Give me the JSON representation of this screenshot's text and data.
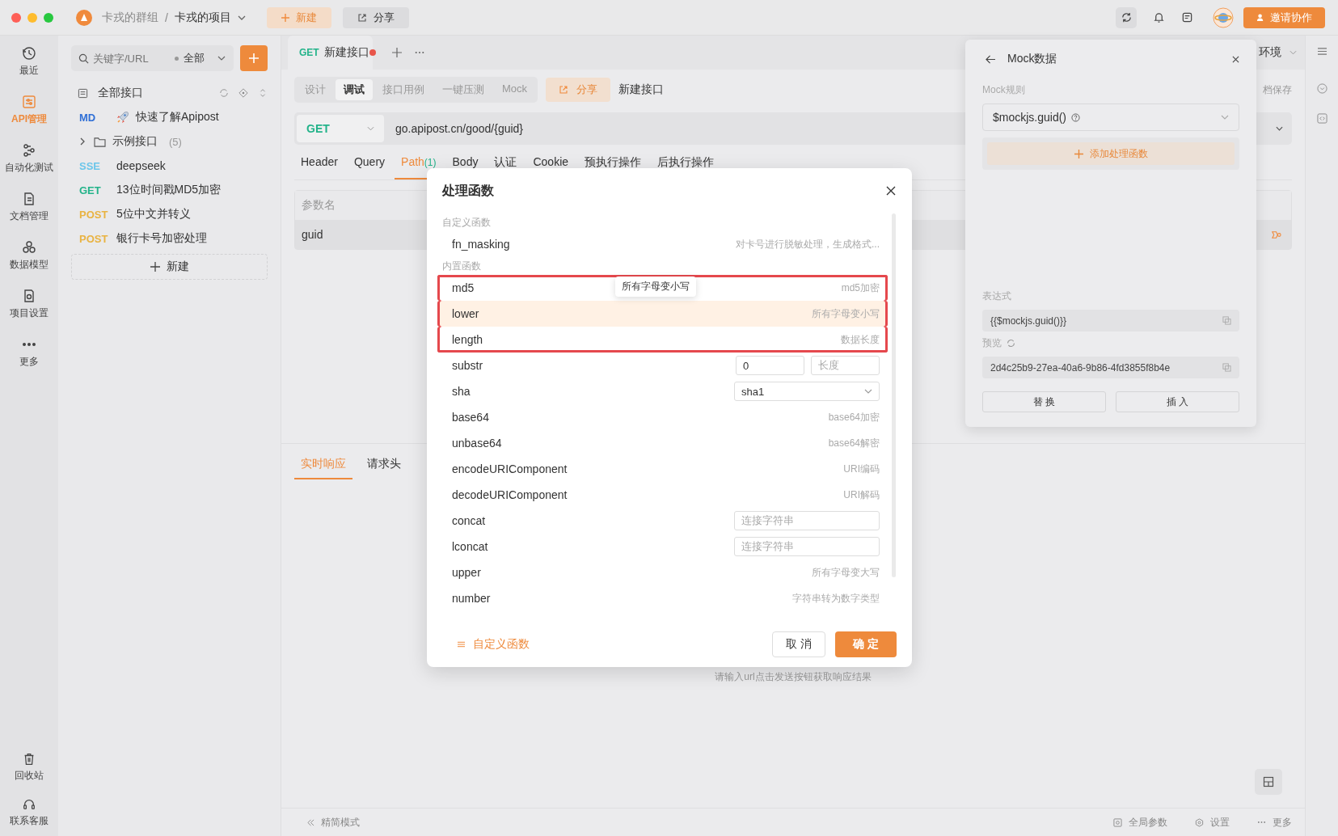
{
  "topbar": {
    "group": "卡戎的群组",
    "separator": "/",
    "project": "卡戎的项目",
    "new_button": "新建",
    "share_button": "分享",
    "invite_button": "邀请协作"
  },
  "rail": {
    "items": [
      {
        "label": "最近",
        "selected": false
      },
      {
        "label": "API管理",
        "selected": true
      },
      {
        "label": "自动化测试",
        "selected": false
      },
      {
        "label": "文档管理",
        "selected": false
      },
      {
        "label": "数据模型",
        "selected": false
      },
      {
        "label": "项目设置",
        "selected": false
      },
      {
        "label": "更多",
        "selected": false
      }
    ],
    "bottom": [
      {
        "label": "回收站"
      },
      {
        "label": "联系客服"
      }
    ]
  },
  "tree": {
    "search_placeholder": "关键字/URL",
    "filter": "全部",
    "root": "全部接口",
    "new_button": "新建",
    "items": [
      {
        "kind": "doc",
        "method": "MD",
        "color": "#2f6fd6",
        "name": "快速了解Apipost"
      },
      {
        "kind": "folder",
        "name": "示例接口",
        "count": "(5)",
        "expanded": false
      },
      {
        "kind": "api",
        "method": "SSE",
        "color": "#6cc6ea",
        "name": "deepseek"
      },
      {
        "kind": "api",
        "method": "GET",
        "color": "#23b38a",
        "name": "13位时间戳MD5加密"
      },
      {
        "kind": "api",
        "method": "POST",
        "color": "#e9b342",
        "name": "5位中文并转义"
      },
      {
        "kind": "api",
        "method": "POST",
        "color": "#e9b342",
        "name": "银行卡号加密处理"
      }
    ]
  },
  "request_tab": {
    "method": "GET",
    "title": "新建接口",
    "unsaved": true
  },
  "env": "环境",
  "mode_tabs": [
    {
      "label": "设计",
      "selected": false
    },
    {
      "label": "调试",
      "selected": true
    },
    {
      "label": "接口用例",
      "selected": false
    },
    {
      "label": "一键压测",
      "selected": false
    },
    {
      "label": "Mock",
      "selected": false
    }
  ],
  "share_button": "分享",
  "api_name": "新建接口",
  "save_label": "档保存",
  "url": {
    "method": "GET",
    "value": "go.apipost.cn/good/{guid}"
  },
  "param_tabs": [
    {
      "label": "Header",
      "selected": false
    },
    {
      "label": "Query",
      "selected": false
    },
    {
      "label": "Path",
      "count": "(1)",
      "selected": true
    },
    {
      "label": "Body",
      "selected": false
    },
    {
      "label": "认证",
      "selected": false
    },
    {
      "label": "Cookie",
      "selected": false
    },
    {
      "label": "预执行操作",
      "selected": false
    },
    {
      "label": "后执行操作",
      "selected": false
    }
  ],
  "params": {
    "column": "参数名",
    "rows": [
      {
        "name": "guid"
      }
    ]
  },
  "response_tabs": [
    {
      "label": "实时响应",
      "selected": true
    },
    {
      "label": "请求头",
      "selected": false
    }
  ],
  "response_empty": "请输入url点击发送按钮获取响应结果",
  "status_bar": {
    "left": "精简模式",
    "items": [
      "全局参数",
      "设置",
      "更多"
    ]
  },
  "modal": {
    "title": "处理函数",
    "tooltip": "所有字母变小写",
    "custom_link": "自定义函数",
    "cancel": "取 消",
    "confirm": "确 定",
    "sections": [
      {
        "label": "自定义函数",
        "rows": [
          {
            "kind": "desc",
            "name": "fn_masking",
            "desc": "对卡号进行脱敏处理，生成格式...",
            "selected": false,
            "annotated": false
          }
        ]
      },
      {
        "label": "内置函数",
        "rows": [
          {
            "kind": "desc",
            "name": "md5",
            "desc": "md5加密",
            "selected": false,
            "annotated": true
          },
          {
            "kind": "desc",
            "name": "lower",
            "desc": "所有字母变小写",
            "selected": true,
            "annotated": true
          },
          {
            "kind": "desc",
            "name": "length",
            "desc": "数据长度",
            "selected": false,
            "annotated": true
          },
          {
            "kind": "pair",
            "name": "substr",
            "value": "0",
            "placeholder": "长度",
            "selected": false,
            "annotated": false
          },
          {
            "kind": "select",
            "name": "sha",
            "value": "sha1",
            "selected": false,
            "annotated": false
          },
          {
            "kind": "desc",
            "name": "base64",
            "desc": "base64加密",
            "selected": false,
            "annotated": false
          },
          {
            "kind": "desc",
            "name": "unbase64",
            "desc": "base64解密",
            "selected": false,
            "annotated": false
          },
          {
            "kind": "desc",
            "name": "encodeURIComponent",
            "desc": "URI编码",
            "selected": false,
            "annotated": false
          },
          {
            "kind": "desc",
            "name": "decodeURIComponent",
            "desc": "URI解码",
            "selected": false,
            "annotated": false
          },
          {
            "kind": "input",
            "name": "concat",
            "placeholder": "连接字符串",
            "selected": false,
            "annotated": false
          },
          {
            "kind": "input",
            "name": "lconcat",
            "placeholder": "连接字符串",
            "selected": false,
            "annotated": false
          },
          {
            "kind": "desc",
            "name": "upper",
            "desc": "所有字母变大写",
            "selected": false,
            "annotated": false
          },
          {
            "kind": "desc",
            "name": "number",
            "desc": "字符串转为数字类型",
            "selected": false,
            "annotated": false
          }
        ]
      }
    ]
  },
  "mock": {
    "title": "Mock数据",
    "rule_label": "Mock规则",
    "rule": "$mockjs.guid()",
    "add_button": "添加处理函数",
    "expr_label": "表达式",
    "expr": "{{$mockjs.guid()}}",
    "preview_label": "预览",
    "preview": "2d4c25b9-27ea-40a6-9b86-4fd3855f8b4e",
    "replace": "替 换",
    "insert": "插 入"
  }
}
